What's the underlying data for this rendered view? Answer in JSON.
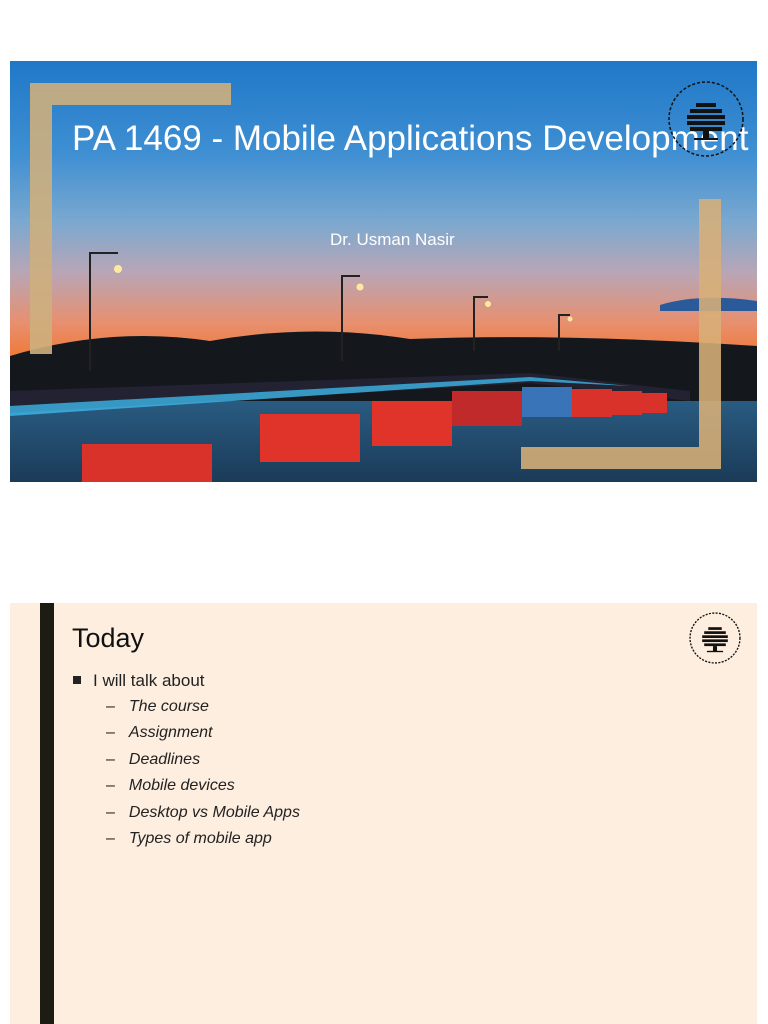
{
  "slide1": {
    "title": "PA 1469 - Mobile Applications Development",
    "author": "Dr. Usman Nasir",
    "logo_text": "BLEKINGE TEKNISKA HÖGSKOLA · BTH ·"
  },
  "slide2": {
    "title": "Today",
    "bullet": "I will talk about",
    "subitems": [
      "The course",
      "Assignment",
      "Deadlines",
      "Mobile devices",
      "Desktop vs Mobile Apps",
      "Types of mobile app"
    ],
    "logo_text": "BLEKINGE TEKNISKA HÖGSKOLA · BTH ·"
  },
  "colors": {
    "frame": "#cdaf7d",
    "slide2_bg": "#fdeee0",
    "accent_bar": "#1c1c12"
  }
}
